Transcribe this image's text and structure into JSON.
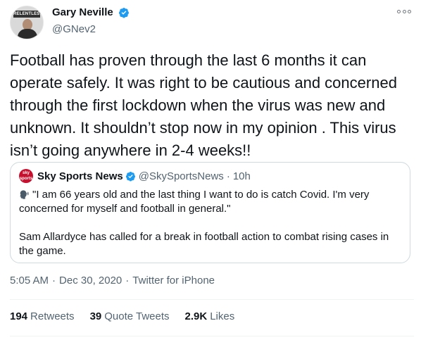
{
  "author": {
    "display_name": "Gary Neville",
    "handle": "@GNev2",
    "avatar_sign_text": "RELENTLESS"
  },
  "tweet": {
    "text": "Football has proven through the last 6 months it can operate safely. It was right to be cautious and concerned through the first lockdown when the virus was new and unknown. It shouldn’t stop now in my opinion . This virus isn’t going anywhere in 2-4 weeks!!"
  },
  "quoted_tweet": {
    "display_name": "Sky Sports News",
    "handle": "@SkySportsNews",
    "separator": "·",
    "time": "10h",
    "avatar_text": "sky sports",
    "paragraph_1": "\"I am 66 years old and the last thing I want to do is catch Covid. I'm very concerned for myself and football in general.\"",
    "paragraph_2": "Sam Allardyce has called for a break in football action to combat rising cases in the game."
  },
  "meta": {
    "time": "5:05 AM",
    "date": "Dec 30, 2020",
    "source": "Twitter for iPhone",
    "separator": "·"
  },
  "stats": {
    "retweets_count": "194",
    "retweets_label": "Retweets",
    "quote_tweets_count": "39",
    "quote_tweets_label": "Quote Tweets",
    "likes_count": "2.9K",
    "likes_label": "Likes"
  },
  "icons": {
    "verified": "verified-badge-icon",
    "more": "more-options-icon",
    "speaking": "speaking-head-icon"
  },
  "colors": {
    "verified_blue": "#1d9bf0",
    "secondary_text": "#536471",
    "border": "#cfd9de",
    "sky_red": "#c8102e"
  }
}
